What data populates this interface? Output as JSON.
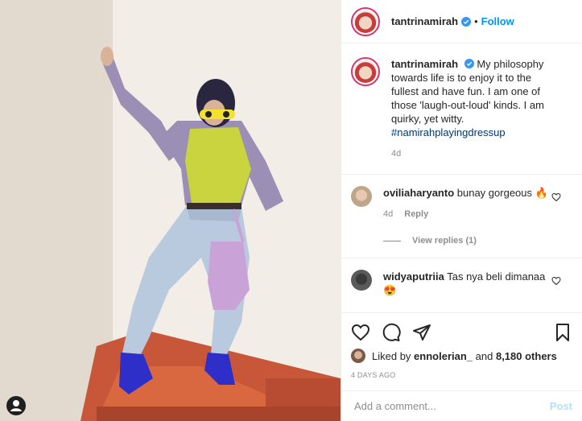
{
  "post": {
    "username": "tantrinamirah",
    "follow_separator": "•",
    "follow_label": "Follow",
    "caption_text": "My philosophy towards life is to enjoy it to the fullest and have fun. I am one of those 'laugh-out-loud' kinds. I am quirky, yet witty.",
    "caption_hashtag": "#namirahplayingdressup",
    "caption_age": "4d"
  },
  "comments": [
    {
      "username": "oviliaharyanto",
      "text": "bunay gorgeous 🔥",
      "age": "4d",
      "reply_label": "Reply",
      "view_replies": "View replies (1)"
    },
    {
      "username": "widyaputriia",
      "text": "Tas nya beli dimanaa😍"
    }
  ],
  "engagement": {
    "liked_by_prefix": "Liked by ",
    "liked_by_user": "ennolerian_",
    "liked_by_and": " and ",
    "liked_by_count": "8,180 others",
    "time_ago": "4 DAYS AGO"
  },
  "composer": {
    "placeholder": "Add a comment...",
    "post_label": "Post"
  },
  "icons": {
    "like": "heart-icon",
    "comment": "comment-icon",
    "share": "share-icon",
    "save": "bookmark-icon",
    "verified": "verified-badge-icon",
    "tag": "user-tag-icon"
  },
  "colors": {
    "link_blue": "#0095f6",
    "hashtag": "#00376b",
    "muted": "#8e8e8e",
    "post_disabled": "#b2dffc"
  }
}
